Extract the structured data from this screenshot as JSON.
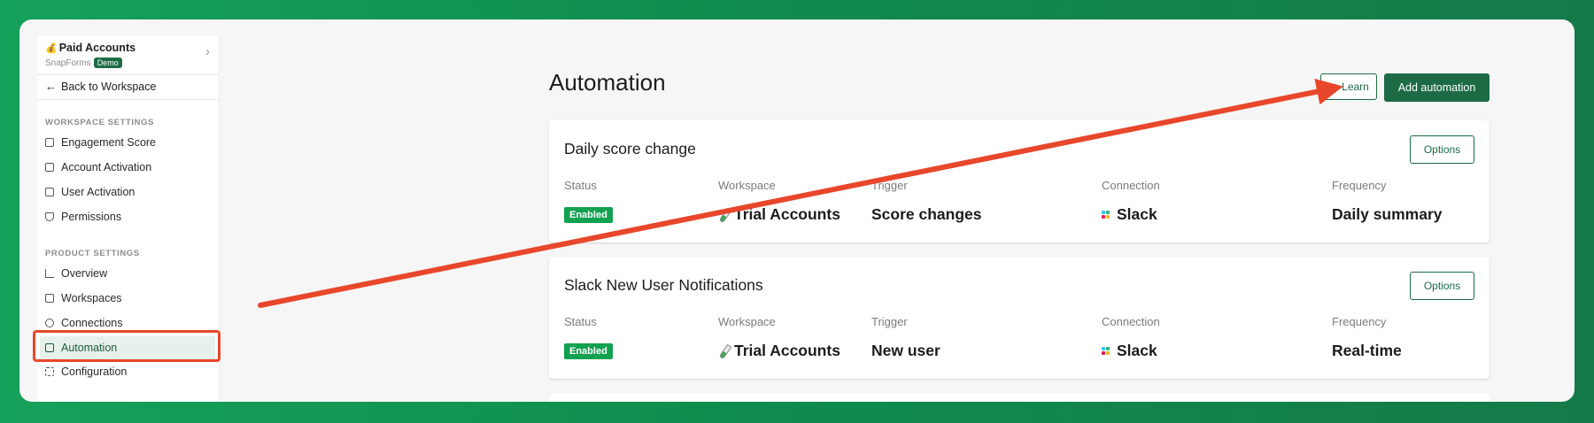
{
  "sidebar": {
    "workspace_icon": "money-bag-icon",
    "workspace_name": "Paid Accounts",
    "workspace_sub": "SnapForms",
    "demo_badge": "Demo",
    "back_label": "Back to Workspace",
    "workspace_settings_heading": "WORKSPACE SETTINGS",
    "workspace_items": [
      "Engagement Score",
      "Account Activation",
      "User Activation",
      "Permissions"
    ],
    "product_settings_heading": "PRODUCT SETTINGS",
    "product_items": [
      "Overview",
      "Workspaces",
      "Connections",
      "Automation",
      "Configuration"
    ],
    "active_item": "Automation"
  },
  "header": {
    "title": "Automation",
    "learn_label": "Learn",
    "add_label": "Add automation"
  },
  "columns": {
    "status": "Status",
    "workspace": "Workspace",
    "trigger": "Trigger",
    "connection": "Connection",
    "frequency": "Frequency"
  },
  "automations": [
    {
      "title": "Daily score change",
      "options_label": "Options",
      "status": "Enabled",
      "workspace": "Trial Accounts",
      "trigger": "Score changes",
      "connection": "Slack",
      "frequency": "Daily summary"
    },
    {
      "title": "Slack New User Notifications",
      "options_label": "Options",
      "status": "Enabled",
      "workspace": "Trial Accounts",
      "trigger": "New user",
      "connection": "Slack",
      "frequency": "Real-time"
    }
  ],
  "colors": {
    "accent": "#1d6b45",
    "status_green": "#12a150",
    "annotation_red": "#e8472b"
  }
}
